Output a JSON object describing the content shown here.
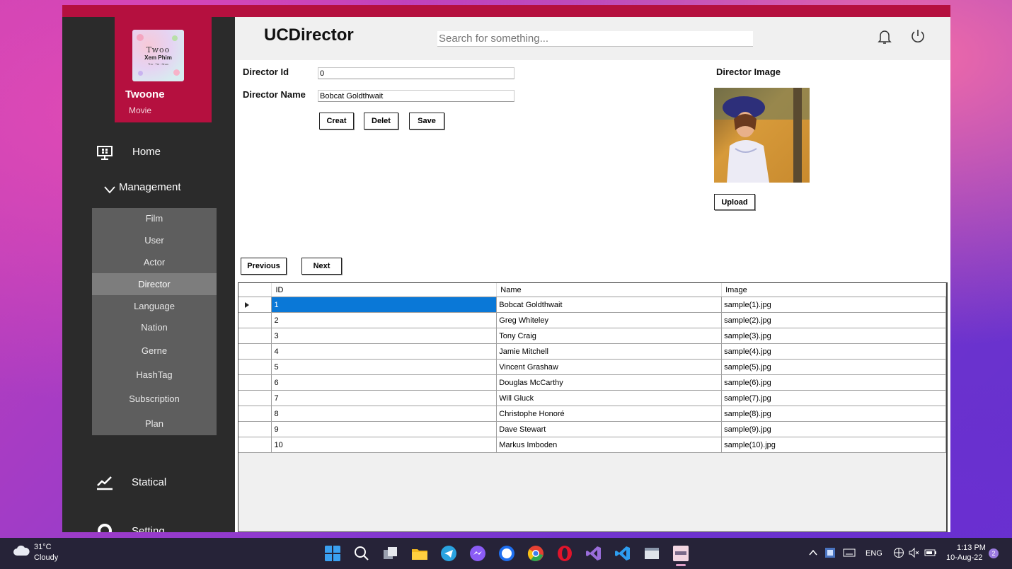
{
  "brand": {
    "name": "Twoone",
    "subtitle": "Movie",
    "logo_line1": "Twoo",
    "logo_line2": "Xem Phim",
    "logo_line3": "Thú · Tài · Nhan"
  },
  "sidebar": {
    "home_label": "Home",
    "management_label": "Management",
    "submenu": [
      {
        "label": "Film"
      },
      {
        "label": "User"
      },
      {
        "label": "Actor"
      },
      {
        "label": "Director",
        "active": true
      },
      {
        "label": "Language"
      },
      {
        "label": "Nation"
      },
      {
        "label": "Gerne"
      },
      {
        "label": "HashTag"
      },
      {
        "label": "Subscription"
      },
      {
        "label": "Plan"
      }
    ],
    "statical_label": "Statical",
    "setting_label": "Setting"
  },
  "header": {
    "title": "UCDirector",
    "search_placeholder": "Search for something...",
    "bell_icon": "bell-icon",
    "power_icon": "power-icon"
  },
  "form": {
    "id_label": "Director Id",
    "id_value": "0",
    "name_label": "Director Name",
    "name_value": "Bobcat Goldthwait",
    "create_label": "Creat",
    "delete_label": "Delet",
    "save_label": "Save",
    "image_label": "Director Image",
    "upload_label": "Upload"
  },
  "pager": {
    "previous_label": "Previous",
    "next_label": "Next"
  },
  "grid": {
    "columns": [
      "ID",
      "Name",
      "Image"
    ],
    "rows": [
      {
        "id": "1",
        "name": "Bobcat Goldthwait",
        "image": "sample(1).jpg",
        "selected": true
      },
      {
        "id": "2",
        "name": "Greg Whiteley",
        "image": "sample(2).jpg"
      },
      {
        "id": "3",
        "name": "Tony Craig",
        "image": "sample(3).jpg"
      },
      {
        "id": "4",
        "name": "Jamie Mitchell",
        "image": "sample(4).jpg"
      },
      {
        "id": "5",
        "name": "Vincent Grashaw",
        "image": "sample(5).jpg"
      },
      {
        "id": "6",
        "name": "Douglas McCarthy",
        "image": "sample(6).jpg"
      },
      {
        "id": "7",
        "name": "Will Gluck",
        "image": "sample(7).jpg"
      },
      {
        "id": "8",
        "name": "Christophe Honoré",
        "image": "sample(8).jpg"
      },
      {
        "id": "9",
        "name": "Dave Stewart",
        "image": "sample(9).jpg"
      },
      {
        "id": "10",
        "name": "Markus Imboden",
        "image": "sample(10).jpg"
      }
    ]
  },
  "taskbar": {
    "weather_temp": "31°C",
    "weather_desc": "Cloudy",
    "language": "ENG",
    "time": "1:13 PM",
    "date": "10-Aug-22",
    "notification_count": "2"
  },
  "colors": {
    "accent": "#b5103f",
    "sidebar": "#2b2b2b",
    "submenu": "#5e5e5e",
    "selection": "#0a78d7"
  }
}
